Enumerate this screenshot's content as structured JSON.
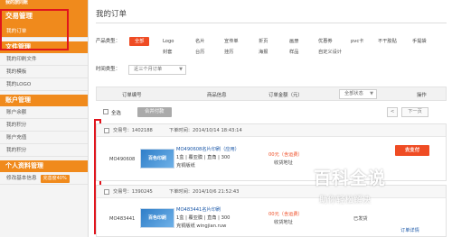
{
  "sidebar": {
    "top_partial": "我的旅同账",
    "trade_section": "交易管理",
    "my_orders": "我的订单",
    "file_section": "文件管理",
    "file_items": [
      "我的印刷文件",
      "我的模板",
      "我的LOGO"
    ],
    "account_section": "账户管理",
    "account_items": [
      "账户余额",
      "我的积分",
      "账户充值",
      "我的积分"
    ],
    "profile_section": "个人资料管理",
    "profile_item": "修改基本信息",
    "profile_flag": "完善度40%"
  },
  "main": {
    "title": "我的订单",
    "product_type_label": "产品类型：",
    "product_types": [
      "全部",
      "Logo",
      "名片",
      "宣传单",
      "折页",
      "画册",
      "优惠券",
      "pvc卡",
      "不干胶贴",
      "手提袋",
      "封套",
      "台历",
      "挂历",
      "海报",
      "样品",
      "自定义设计"
    ],
    "time_type_label": "时间类型：",
    "time_select": "近三个月订单",
    "columns": {
      "order_no": "订单编号",
      "product_info": "商品信息",
      "amount": "订单金额（元）",
      "status": "全部状态",
      "operation": "操作"
    },
    "select_all": "全选",
    "merge_pay": "合并付款",
    "prev_page": "<",
    "next_page": "下一页"
  },
  "orders": [
    {
      "tx_no": "交易号：1402188",
      "order_time": "下单时间：2014/10/14 18:43:14",
      "order_id": "MO490608",
      "thumb_text": "百色印刷",
      "product_link": "MO490608名片印刷（应用）",
      "spec_line1": "1盒 | 覆亚膜 | 直角 | 300",
      "spec_line2": "克铜版纸",
      "price": "00元（含运费）",
      "pay_note": "收货地址",
      "action": "去支付"
    },
    {
      "tx_no": "交易号：1390245",
      "order_time": "下单时间：2014/10/6 21:52:43",
      "order_id": "MO483441",
      "thumb_text": "百色印刷",
      "product_link": "MO483441名片印刷",
      "spec_line1": "1盒 | 覆亚膜 | 直角 | 300",
      "spec_line2": "克铜版纸 wingjian.ruw",
      "price": "00元（含运费）",
      "pay_note": "收货地址",
      "status": "已发货",
      "action_link": "订单详情"
    }
  ],
  "watermark": {
    "title": "百科全说",
    "subtitle": "助你轻松解决"
  },
  "colors": {
    "accent_orange": "#f08a1c",
    "action_red": "#ef4c24",
    "annotation_red": "#e0151d",
    "link_blue": "#1a57a8"
  }
}
